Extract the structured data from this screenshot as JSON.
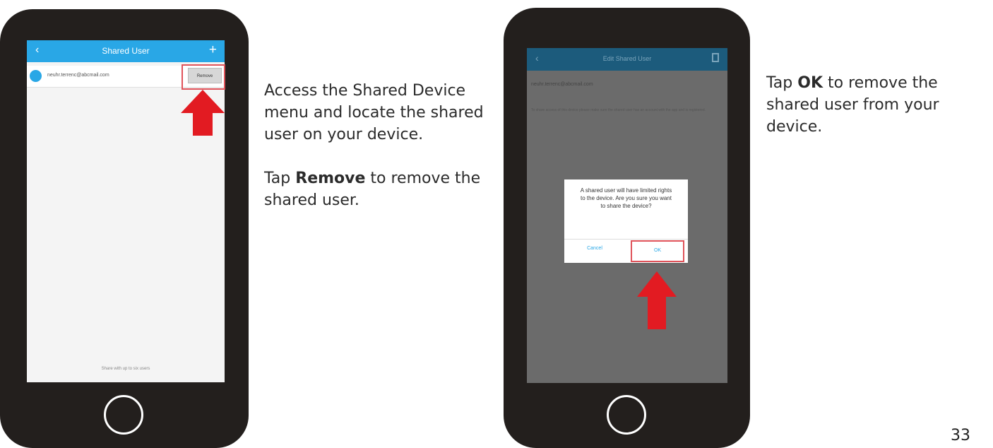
{
  "phone1": {
    "app_title": "Shared User",
    "back_glyph": "‹",
    "add_glyph": "+",
    "user_email": "neuhr.terrenc@abcmail.com",
    "remove_label": "Remove",
    "footer": "Share with up to six users",
    "accent_color": "#29a7e6"
  },
  "phone2": {
    "app_title": "Edit Shared User",
    "back_glyph": "‹",
    "user_email": "neuhr.terrenc@abcmail.com",
    "note": "To share access of this device please make sure the shared user has an account with the app and is registered.",
    "dialog": {
      "message": "A shared user will have limited rights to the device. Are you sure you want to share the device?",
      "cancel_label": "Cancel",
      "ok_label": "OK"
    }
  },
  "caption1": {
    "line1": "Access the Shared Device menu and locate the shared user on your device.",
    "line2_pre": "Tap ",
    "line2_bold": "Remove",
    "line2_post": " to remove the shared user."
  },
  "caption2": {
    "pre": "Tap ",
    "bold": "OK",
    "post": " to remove the shared user from your device."
  },
  "page_number": "33",
  "colors": {
    "arrow": "#e21b22",
    "highlight": "#e0535a"
  }
}
